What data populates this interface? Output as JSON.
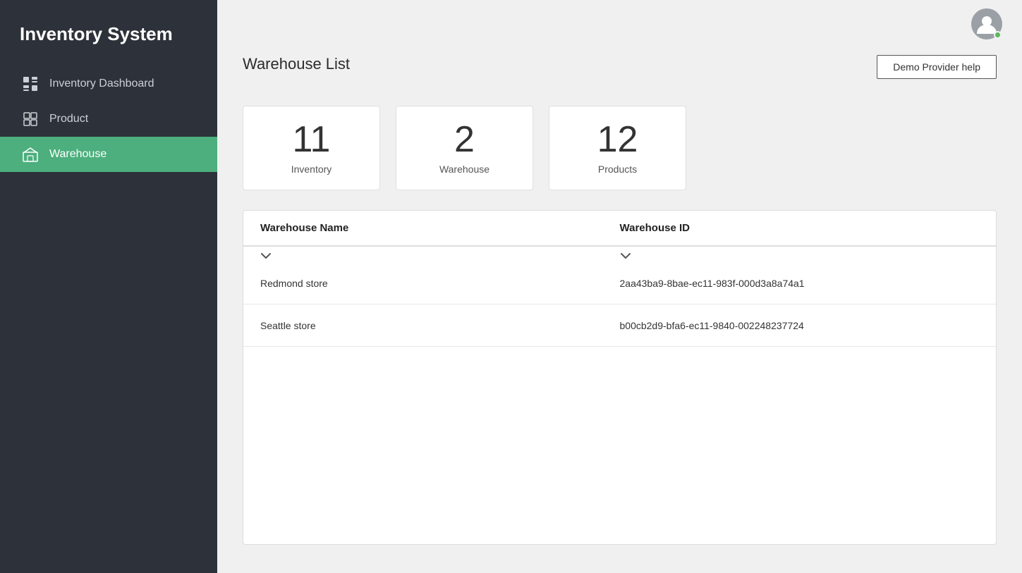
{
  "app": {
    "title": "Inventory System"
  },
  "sidebar": {
    "items": [
      {
        "id": "inventory-dashboard",
        "label": "Inventory Dashboard",
        "active": false
      },
      {
        "id": "product",
        "label": "Product",
        "active": false
      },
      {
        "id": "warehouse",
        "label": "Warehouse",
        "active": true
      }
    ]
  },
  "header": {
    "help_button_label": "Demo Provider help"
  },
  "page": {
    "title": "Warehouse List"
  },
  "stats": [
    {
      "id": "inventory",
      "number": "11",
      "label": "Inventory"
    },
    {
      "id": "warehouse",
      "number": "2",
      "label": "Warehouse"
    },
    {
      "id": "products",
      "number": "12",
      "label": "Products"
    }
  ],
  "table": {
    "columns": [
      {
        "id": "warehouse-name",
        "label": "Warehouse Name"
      },
      {
        "id": "warehouse-id",
        "label": "Warehouse ID"
      }
    ],
    "rows": [
      {
        "name": "Redmond store",
        "id": "2aa43ba9-8bae-ec11-983f-000d3a8a74a1"
      },
      {
        "name": "Seattle store",
        "id": "b00cb2d9-bfa6-ec11-9840-002248237724"
      }
    ]
  }
}
